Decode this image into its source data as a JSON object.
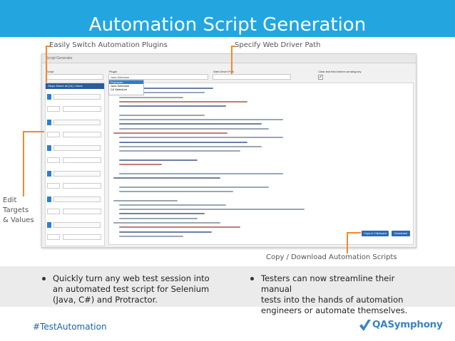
{
  "slide": {
    "title": "Automation Script Generation",
    "callouts": {
      "plugins": "Easily Switch Automation Plugins",
      "driver_path": "Specify Web Driver Path",
      "edit_targets": "Edit Targets\n& Values",
      "copy_download": "Copy / Download Automation Scripts"
    },
    "bullets": [
      "Quickly turn any web test session into\nan automated test script for Selenium\n(Java, C#) and Protractor.",
      "Testers can now streamline their manual\ntests into the hands of automation\nengineers or automate themselves."
    ],
    "hashtag": "#TestAutomation",
    "logo_text": "QASymphony",
    "colors": {
      "title_bar": "#23a6e0",
      "callout_line": "#f5882a",
      "hashtag": "#1a62b7",
      "logo": "#3b83c9"
    }
  },
  "app": {
    "header": "Script Generator",
    "fields": {
      "script_label": "Script",
      "plugin_label": "Plugin",
      "driver_label": "Web Driver Path",
      "clear_label": "Clear test field before sending key",
      "plugin_value": "Java Selenium"
    },
    "plugin_options": [
      "Protractor",
      "Java Selenium",
      "C# Selenium"
    ],
    "steps_header": "Steps  Select all (14) / None",
    "buttons": {
      "copy": "Copy to Clipboard",
      "download": "Download"
    },
    "icons": {
      "check": "checkmark-icon",
      "logo_mark": "qasymphony-checkmark-logo"
    }
  }
}
